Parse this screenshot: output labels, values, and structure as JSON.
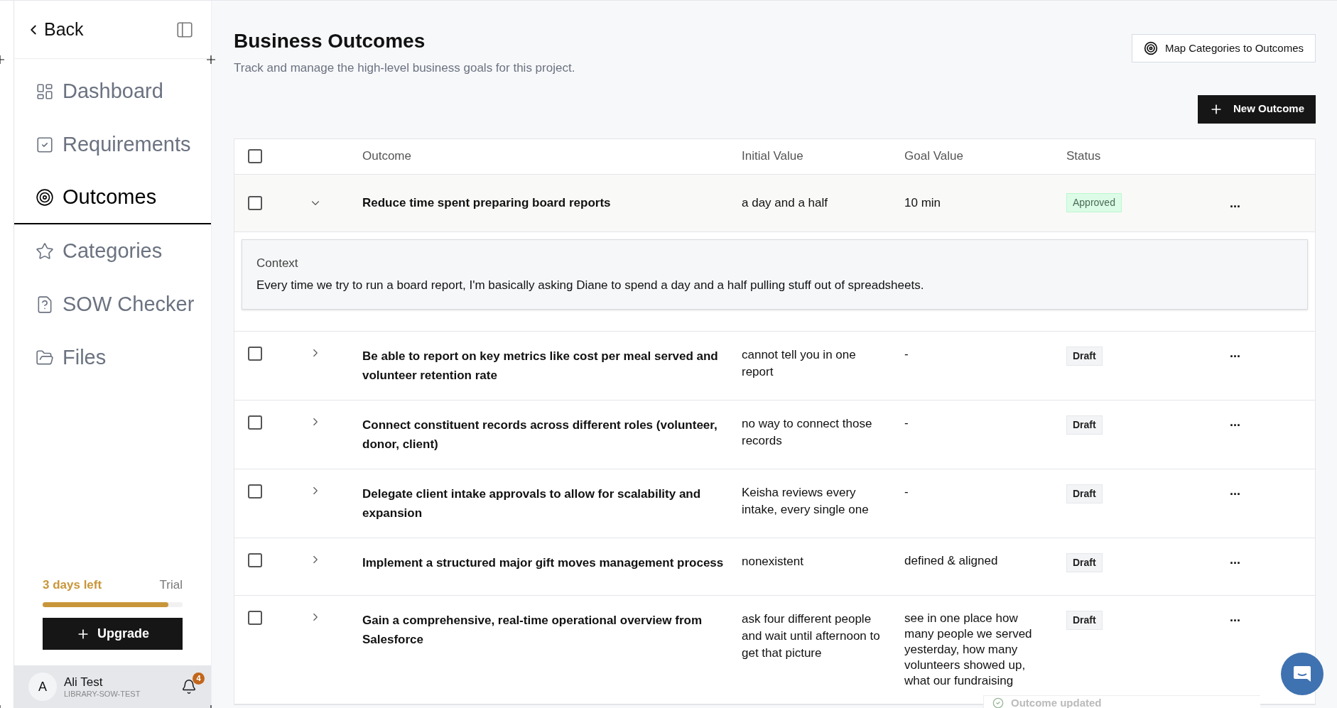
{
  "sidebar": {
    "back": "Back",
    "items": [
      {
        "label": "Dashboard",
        "selected": false
      },
      {
        "label": "Requirements",
        "selected": false
      },
      {
        "label": "Outcomes",
        "selected": true
      },
      {
        "label": "Categories",
        "selected": false
      },
      {
        "label": "SOW Checker",
        "selected": false
      },
      {
        "label": "Files",
        "selected": false
      }
    ],
    "trial": {
      "days_left": "3 days left",
      "plan": "Trial",
      "level": 0.9
    },
    "upgrade": "Upgrade",
    "user": {
      "initial": "A",
      "name": "Ali Test",
      "org": "LIBRARY-SOW-TEST",
      "notifications": "4"
    }
  },
  "header": {
    "title": "Business Outcomes",
    "subtitle": "Track and manage the high-level business goals for this project.",
    "map_button": "Map Categories to Outcomes",
    "new_button": "New Outcome"
  },
  "table": {
    "select_all_checked": false,
    "columns": [
      "Outcome",
      "Initial Value",
      "Goal Value",
      "Status"
    ],
    "rows": [
      {
        "checked": false,
        "expanded": true,
        "outcome": "Reduce time spent preparing board reports",
        "initial": "a day and a half",
        "goal": "10 min",
        "status": "Approved",
        "color": "#dcfce7",
        "menu": "...",
        "context_label": "Context",
        "context": "Every time we try to run a board report, I'm basically asking Diane to spend a day and a half pulling stuff out of spreadsheets."
      },
      {
        "checked": false,
        "expanded": false,
        "outcome": "Be able to report on key metrics like cost per meal served and volunteer retention rate",
        "initial": "cannot tell you in one report",
        "goal": "-",
        "status": "Draft",
        "color": "#f3f4f6",
        "menu": "..."
      },
      {
        "checked": false,
        "expanded": false,
        "outcome": "Connect constituent records across different roles (volunteer, donor, client)",
        "initial": "no way to connect those records",
        "goal": "-",
        "status": "Draft",
        "color": "#f3f4f6",
        "menu": "..."
      },
      {
        "checked": false,
        "expanded": false,
        "outcome": "Delegate client intake approvals to allow for scalability and expansion",
        "initial": "Keisha reviews every intake, every single one",
        "goal": "-",
        "status": "Draft",
        "color": "#f3f4f6",
        "menu": "..."
      },
      {
        "checked": false,
        "expanded": false,
        "outcome": "Implement a structured major gift moves management process",
        "initial": "nonexistent",
        "goal": "defined & aligned",
        "status": "Draft",
        "color": "#f3f4f6",
        "menu": "..."
      },
      {
        "checked": false,
        "expanded": false,
        "outcome": "Gain a comprehensive, real-time operational overview from Salesforce",
        "initial": "ask four different people and wait until afternoon to get that picture",
        "goal": "see in one place how many people we served yesterday, how many volunteers showed up, what our fundraising",
        "status": "Draft",
        "color": "#f3f4f6",
        "menu": "..."
      }
    ]
  },
  "toast": {
    "message": "Outcome updated"
  }
}
